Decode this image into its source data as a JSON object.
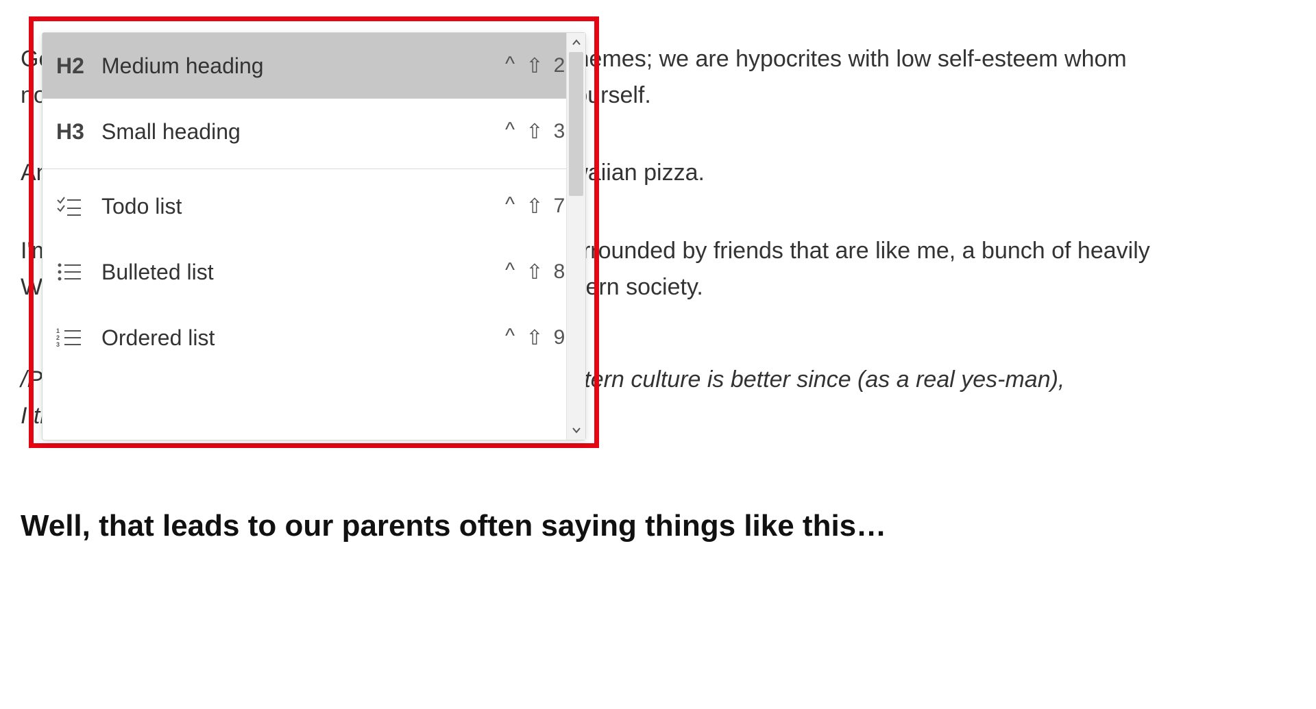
{
  "document": {
    "para1_line1": "Gen Z folks in my country often say things like this in memes; we are hypocrites with low self-esteem whom",
    "para1_line2": "no one loves. Thus we have to compensate by loving ourself.",
    "para2": "And the thing we even disagree with each other is Hawaiian pizza.",
    "para3_line1": "I'm one of the overseas Chinese millennials and I'm surrounded by friends that are like me, a bunch of heavily",
    "para3_line2": "Westernized millennials or Gen Z who grew up in Western society.",
    "note_line1": "/Please note, I'm not debating whether Western or Eastern culture is better since (as a real yes-man),",
    "note_line2": "I think each has its own merit.",
    "heading": "Well, that leads to our parents often saying things like this…"
  },
  "menu": {
    "items": [
      {
        "icon_label": "H2",
        "label": "Medium heading",
        "shortcut_num": "2",
        "highlight": true,
        "kind": "text"
      },
      {
        "icon_label": "H3",
        "label": "Small heading",
        "shortcut_num": "3",
        "highlight": false,
        "kind": "text"
      },
      {
        "sep": true
      },
      {
        "icon_label": "todo",
        "label": "Todo list",
        "shortcut_num": "7",
        "highlight": false,
        "kind": "svg"
      },
      {
        "icon_label": "bulleted",
        "label": "Bulleted list",
        "shortcut_num": "8",
        "highlight": false,
        "kind": "svg"
      },
      {
        "icon_label": "ordered",
        "label": "Ordered list",
        "shortcut_num": "9",
        "highlight": false,
        "kind": "svg"
      }
    ],
    "shortcut_prefix_caret": "^",
    "shortcut_prefix_shift": "⇧"
  },
  "annotation": {
    "highlight_color": "#e30613"
  }
}
